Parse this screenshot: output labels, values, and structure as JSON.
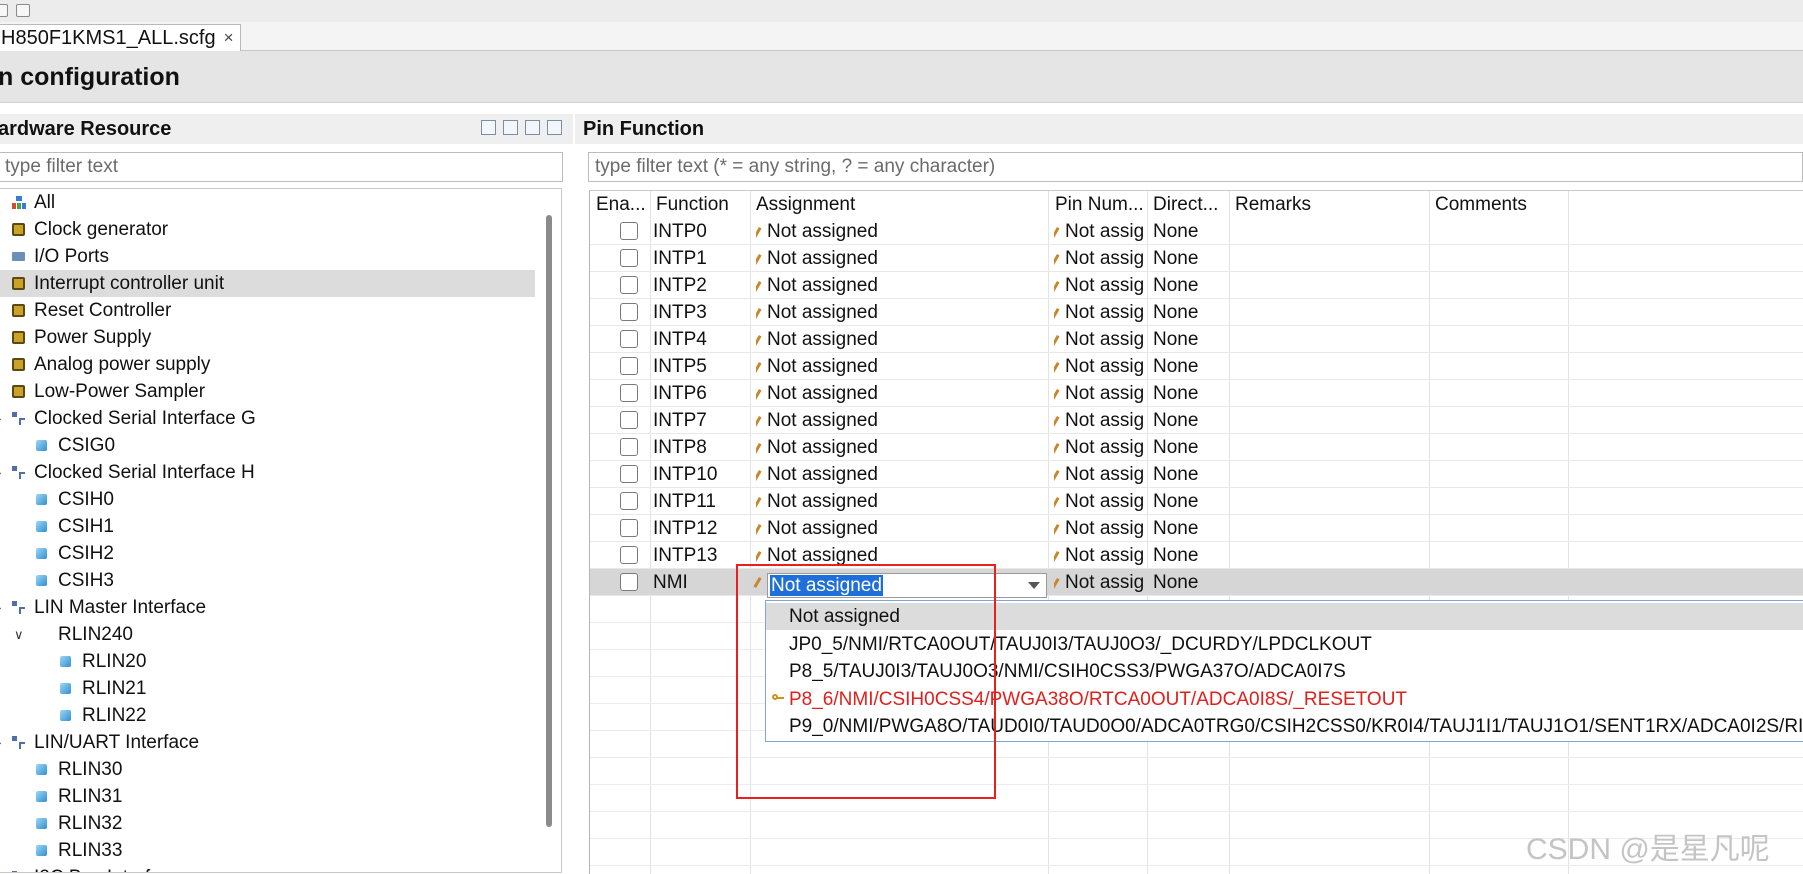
{
  "editor_tab": {
    "title": "H850F1KMS1_ALL.scfg",
    "close": "×"
  },
  "page": {
    "title": "n configuration"
  },
  "left_panel": {
    "title": "ardware Resource",
    "filter_placeholder": "type filter text",
    "tree": [
      {
        "label": "All",
        "icon": "all-icon"
      },
      {
        "label": "Clock generator",
        "icon": "chip-icon"
      },
      {
        "label": "I/O Ports",
        "icon": "io-icon"
      },
      {
        "label": "Interrupt controller unit",
        "icon": "chip-icon",
        "selected": true
      },
      {
        "label": "Reset Controller",
        "icon": "chip-icon"
      },
      {
        "label": "Power Supply",
        "icon": "chip-icon"
      },
      {
        "label": "Analog power supply",
        "icon": "chip-icon"
      },
      {
        "label": "Low-Power Sampler",
        "icon": "chip-icon"
      },
      {
        "label": "Clocked Serial Interface G",
        "icon": "tree-icon"
      },
      {
        "label": "CSIG0",
        "icon": "cube-icon"
      },
      {
        "label": "Clocked Serial Interface H",
        "icon": "tree-icon"
      },
      {
        "label": "CSIH0",
        "icon": "cube-icon"
      },
      {
        "label": "CSIH1",
        "icon": "cube-icon"
      },
      {
        "label": "CSIH2",
        "icon": "cube-icon"
      },
      {
        "label": "CSIH3",
        "icon": "cube-icon"
      },
      {
        "label": "LIN Master Interface",
        "icon": "tree-icon"
      },
      {
        "label": "RLIN240",
        "icon": "none",
        "twisty": "∨"
      },
      {
        "label": "RLIN20",
        "icon": "cube-icon"
      },
      {
        "label": "RLIN21",
        "icon": "cube-icon"
      },
      {
        "label": "RLIN22",
        "icon": "cube-icon"
      },
      {
        "label": "LIN/UART Interface",
        "icon": "tree-icon"
      },
      {
        "label": "RLIN30",
        "icon": "cube-icon"
      },
      {
        "label": "RLIN31",
        "icon": "cube-icon"
      },
      {
        "label": "RLIN32",
        "icon": "cube-icon"
      },
      {
        "label": "RLIN33",
        "icon": "cube-icon"
      },
      {
        "label": "I2C Bus Interfac",
        "icon": "tree-icon"
      }
    ]
  },
  "right_panel": {
    "title": "Pin Function",
    "filter_placeholder": "type filter text (* = any string, ? = any character)",
    "columns": [
      "Ena...",
      "Function",
      "Assignment",
      "Pin Num...",
      "Direct...",
      "Remarks",
      "Comments"
    ],
    "rows": [
      {
        "function": "INTP0",
        "assignment": "Not assigned",
        "pin": "Not assig",
        "direction": "None"
      },
      {
        "function": "INTP1",
        "assignment": "Not assigned",
        "pin": "Not assig",
        "direction": "None"
      },
      {
        "function": "INTP2",
        "assignment": "Not assigned",
        "pin": "Not assig",
        "direction": "None"
      },
      {
        "function": "INTP3",
        "assignment": "Not assigned",
        "pin": "Not assig",
        "direction": "None"
      },
      {
        "function": "INTP4",
        "assignment": "Not assigned",
        "pin": "Not assig",
        "direction": "None"
      },
      {
        "function": "INTP5",
        "assignment": "Not assigned",
        "pin": "Not assig",
        "direction": "None"
      },
      {
        "function": "INTP6",
        "assignment": "Not assigned",
        "pin": "Not assig",
        "direction": "None"
      },
      {
        "function": "INTP7",
        "assignment": "Not assigned",
        "pin": "Not assig",
        "direction": "None"
      },
      {
        "function": "INTP8",
        "assignment": "Not assigned",
        "pin": "Not assig",
        "direction": "None"
      },
      {
        "function": "INTP10",
        "assignment": "Not assigned",
        "pin": "Not assig",
        "direction": "None"
      },
      {
        "function": "INTP11",
        "assignment": "Not assigned",
        "pin": "Not assig",
        "direction": "None"
      },
      {
        "function": "INTP12",
        "assignment": "Not assigned",
        "pin": "Not assig",
        "direction": "None"
      },
      {
        "function": "INTP13",
        "assignment": "Not assigned",
        "pin": "Not assig",
        "direction": "None"
      },
      {
        "function": "NMI",
        "assignment": "Not assigned",
        "pin": "Not assig",
        "direction": "None",
        "editing": true
      }
    ],
    "dropdown_options": [
      {
        "label": "Not assigned",
        "highlighted": true
      },
      {
        "label": "JP0_5/NMI/RTCA0OUT/TAUJ0I3/TAUJ0O3/_DCURDY/LPDCLKOUT"
      },
      {
        "label": "P8_5/TAUJ0I3/TAUJ0O3/NMI/CSIH0CSS3/PWGA37O/ADCA0I7S"
      },
      {
        "label": "P8_6/NMI/CSIH0CSS4/PWGA38O/RTCA0OUT/ADCA0I8S/_RESETOUT",
        "conflict": true
      },
      {
        "label": "P9_0/NMI/PWGA8O/TAUD0I0/TAUD0O0/ADCA0TRG0/CSIH2CSS0/KR0I4/TAUJ1I1/TAUJ1O1/SENT1RX/ADCA0I2S/RII"
      }
    ]
  },
  "watermark": "CSDN @是星凡呢",
  "colors": {
    "selection": "#1e6fd9",
    "conflict": "#e0201c",
    "annotation": "#e8211c"
  }
}
